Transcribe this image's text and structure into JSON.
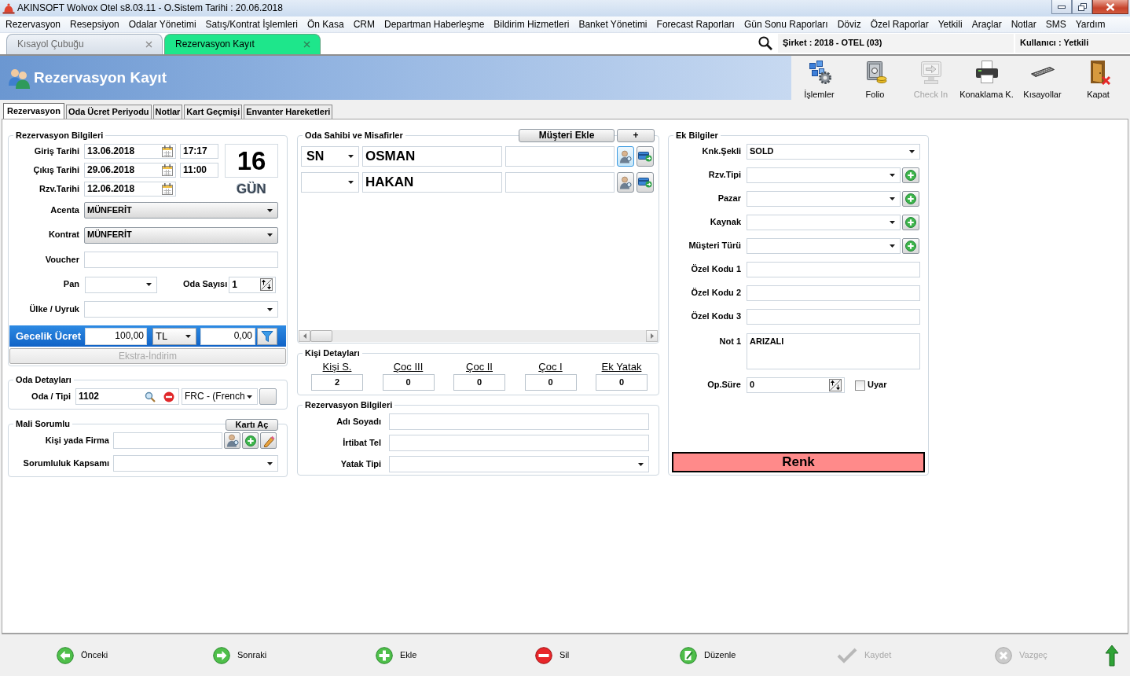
{
  "window": {
    "title": "AKINSOFT Wolvox Otel s8.03.11 - O.Sistem Tarihi : 20.06.2018"
  },
  "menu": [
    "Rezervasyon",
    "Resepsiyon",
    "Odalar Yönetimi",
    "Satış/Kontrat İşlemleri",
    "Ön Kasa",
    "CRM",
    "Departman Haberleşme",
    "Bildirim Hizmetleri",
    "Banket Yönetimi",
    "Forecast Raporları",
    "Gün Sonu Raporları",
    "Döviz",
    "Özel Raporlar",
    "Yetkili",
    "Araçlar",
    "Notlar",
    "SMS",
    "Yardım"
  ],
  "doc_tabs": [
    {
      "label": "Kısayol Çubuğu",
      "selected": false
    },
    {
      "label": "Rezervasyon Kayıt",
      "selected": true
    }
  ],
  "session": {
    "company": "Şirket : 2018 - OTEL (03)",
    "user": "Kullanıcı : Yetkili"
  },
  "header": {
    "title": "Rezervasyon Kayıt"
  },
  "toolbar": [
    {
      "kind": "operations",
      "label": "İşlemler",
      "disabled": false
    },
    {
      "kind": "folio",
      "label": "Folio",
      "disabled": false
    },
    {
      "kind": "checkin",
      "label": "Check In",
      "disabled": true
    },
    {
      "kind": "print",
      "label": "Konaklama K.",
      "disabled": false
    },
    {
      "kind": "shortcuts",
      "label": "Kısayollar",
      "disabled": false
    },
    {
      "kind": "close",
      "label": "Kapat",
      "disabled": false
    }
  ],
  "form_tabs": [
    {
      "label": "Rezervasyon",
      "selected": true
    },
    {
      "label": "Oda Ücret Periyodu",
      "selected": false
    },
    {
      "label": "Notlar",
      "selected": false
    },
    {
      "label": "Kart Geçmişi",
      "selected": false
    },
    {
      "label": "Envanter Hareketleri",
      "selected": false
    }
  ],
  "reservation": {
    "title": "Rezervasyon Bilgileri",
    "dates": [
      {
        "label": "Giriş Tarihi",
        "date": "13.06.2018",
        "time": "17:17"
      },
      {
        "label": "Çıkış Tarihi",
        "date": "29.06.2018",
        "time": "11:00"
      },
      {
        "label": "Rzv.Tarihi",
        "date": "12.06.2018"
      }
    ],
    "nights": "16",
    "nights_unit": "GÜN",
    "fields": [
      {
        "kind": "combo",
        "label": "Acenta",
        "value": "MÜNFERİT"
      },
      {
        "kind": "combo",
        "label": "Kontrat",
        "value": "MÜNFERİT"
      },
      {
        "kind": "input",
        "label": "Voucher"
      },
      {
        "kind": "board",
        "label": "Pan",
        "count_label": "Oda Sayısı",
        "count": "1"
      },
      {
        "kind": "select",
        "label": "Ülke / Uyruk"
      }
    ],
    "rate": {
      "label": "Gecelik Ücret",
      "amount": "100,00",
      "currency": "TL",
      "discount": "0,00"
    },
    "extra_button": {
      "label": "Ekstra-İndirim",
      "disabled": true
    }
  },
  "room": {
    "title": "Oda Detayları",
    "label": "Oda / Tipi",
    "number": "1102",
    "type": "FRC - (French"
  },
  "payer": {
    "title": "Mali Sorumlu",
    "open_button": "Kartı Aç",
    "firm_label": "Kişi yada Firma",
    "scope_label": "Sorumluluk Kapsamı"
  },
  "guests": {
    "title": "Oda Sahibi ve Misafirler",
    "add_button": "Müşteri Ekle",
    "plus_button": "+",
    "rows": [
      {
        "salutation": "SN",
        "name": "OSMAN",
        "selected": true
      },
      {
        "name": "HAKAN",
        "selected": false
      }
    ]
  },
  "person_counts": {
    "title": "Kişi Detayları",
    "columns": [
      {
        "label": "Kişi S.",
        "value": "2"
      },
      {
        "label": "Çoc III",
        "value": "0"
      },
      {
        "label": "Çoc II",
        "value": "0"
      },
      {
        "label": "Çoc I",
        "value": "0"
      },
      {
        "label": "Ek Yatak",
        "value": "0"
      }
    ]
  },
  "contact": {
    "title": "Rezervasyon Bilgileri",
    "fields": [
      {
        "kind": "input",
        "label": "Adı Soyadı"
      },
      {
        "kind": "input",
        "label": "İrtibat Tel"
      },
      {
        "kind": "select",
        "label": "Yatak Tipi"
      }
    ]
  },
  "extra": {
    "title": "Ek Bilgiler",
    "fields": [
      {
        "kind": "select",
        "label": "Knk.Şekli",
        "value": "SOLD"
      },
      {
        "kind": "select_add",
        "label": "Rzv.Tipi"
      },
      {
        "kind": "select_add",
        "label": "Pazar"
      },
      {
        "kind": "select_add",
        "label": "Kaynak"
      },
      {
        "kind": "select_add",
        "label": "Müşteri Türü"
      },
      {
        "kind": "input",
        "label": "Özel Kodu 1"
      },
      {
        "kind": "input",
        "label": "Özel Kodu 2"
      },
      {
        "kind": "input",
        "label": "Özel Kodu 3"
      },
      {
        "kind": "textarea",
        "label": "Not 1",
        "value": "ARIZALI"
      },
      {
        "kind": "spinner",
        "label": "Op.Süre",
        "value": "0",
        "check_label": "Uyar",
        "checked": false
      }
    ],
    "color_button": "Renk"
  },
  "nav_buttons": [
    {
      "kind": "prev",
      "label": "Önceki",
      "disabled": false
    },
    {
      "kind": "next",
      "label": "Sonraki",
      "disabled": false
    },
    {
      "kind": "add",
      "label": "Ekle",
      "disabled": false
    },
    {
      "kind": "delete",
      "label": "Sil",
      "disabled": false
    },
    {
      "kind": "edit",
      "label": "Düzenle",
      "disabled": false
    },
    {
      "kind": "save",
      "label": "Kaydet",
      "disabled": true
    },
    {
      "kind": "cancel",
      "label": "Vazgeç",
      "disabled": true
    }
  ]
}
